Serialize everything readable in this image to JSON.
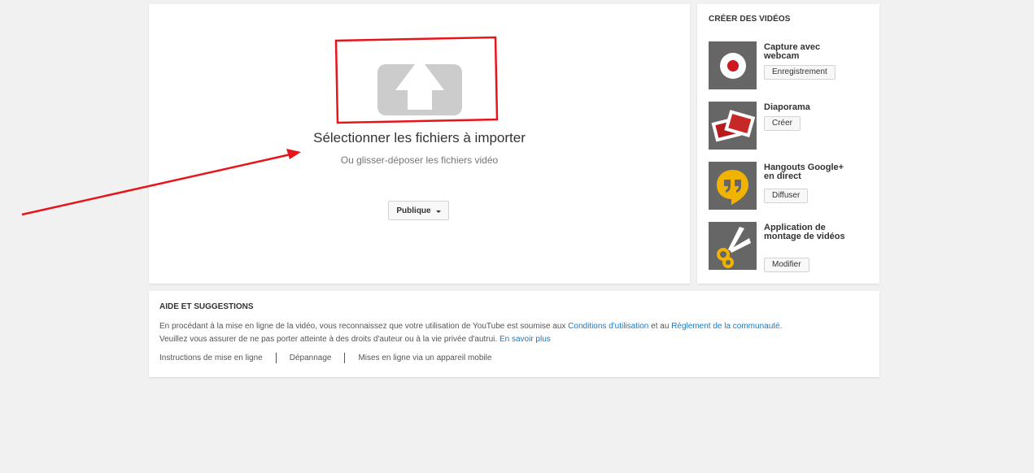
{
  "upload": {
    "select_files": "Sélectionner les fichiers à importer",
    "drag_hint": "Ou glisser-déposer les fichiers vidéo",
    "privacy_value": "Publique"
  },
  "create": {
    "title": "CRÉER DES VIDÉOS",
    "tools": [
      {
        "name": "Capture avec webcam",
        "button": "Enregistrement",
        "icon": "record-icon"
      },
      {
        "name": "Diaporama",
        "button": "Créer",
        "icon": "photos-icon"
      },
      {
        "name": "Hangouts Google+ en direct",
        "button": "Diffuser",
        "icon": "hangouts-icon"
      },
      {
        "name": "Application de montage de vidéos",
        "button": "Modifier",
        "icon": "scissors-icon"
      }
    ]
  },
  "help": {
    "title": "AIDE ET SUGGESTIONS",
    "text_1": "En procédant à la mise en ligne de la vidéo, vous reconnaissez que votre utilisation de YouTube est soumise aux ",
    "terms_link": "Conditions d'utilisation",
    "text_2": " et au ",
    "community_link": "Règlement de la communauté",
    "text_3": ".",
    "text_4": "Veuillez vous assurer de ne pas porter atteinte à des droits d'auteur ou à la vie privée d'autrui. ",
    "learn_more_link": "En savoir plus",
    "links": [
      "Instructions de mise en ligne",
      "Dépannage",
      "Mises en ligne via un appareil mobile"
    ]
  },
  "colors": {
    "annotation": "#e8141b",
    "link": "#167ac6",
    "record_red": "#cc181e",
    "hangouts_yellow": "#f0b400",
    "background": "#f1f1f1"
  }
}
